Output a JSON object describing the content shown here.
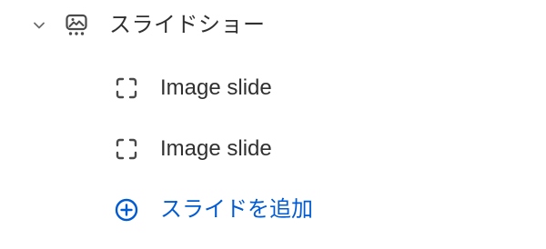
{
  "section": {
    "label": "スライドショー",
    "expand_icon": "chevron-down-icon",
    "icon": "slideshow-icon"
  },
  "children": [
    {
      "label": "Image slide",
      "icon": "image-slide-icon"
    },
    {
      "label": "Image slide",
      "icon": "image-slide-icon"
    }
  ],
  "add_action": {
    "label": "スライドを追加",
    "icon": "plus-circle-icon"
  },
  "colors": {
    "text": "#303030",
    "icon": "#4a4a4a",
    "accent": "#005bd3"
  }
}
